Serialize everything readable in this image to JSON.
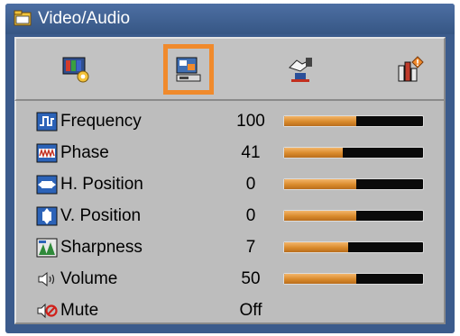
{
  "window": {
    "title": "Video/Audio",
    "title_icon": "folder-icon"
  },
  "tabs": [
    {
      "icon": "image-settings-icon",
      "active": false
    },
    {
      "icon": "video-audio-icon",
      "active": true
    },
    {
      "icon": "setup-hand-icon",
      "active": false
    },
    {
      "icon": "options-icon",
      "active": false
    }
  ],
  "items": [
    {
      "label": "Frequency",
      "value": "100",
      "icon": "frequency-icon",
      "level": 0.52
    },
    {
      "label": "Phase",
      "value": "41",
      "icon": "phase-icon",
      "level": 0.42
    },
    {
      "label": "H. Position",
      "value": "0",
      "icon": "h-position-icon",
      "level": 0.52
    },
    {
      "label": "V. Position",
      "value": "0",
      "icon": "v-position-icon",
      "level": 0.52
    },
    {
      "label": "Sharpness",
      "value": "7",
      "icon": "sharpness-icon",
      "level": 0.46
    },
    {
      "label": "Volume",
      "value": "50",
      "icon": "volume-icon",
      "level": 0.52
    },
    {
      "label": "Mute",
      "value": "Off",
      "icon": "mute-icon"
    }
  ],
  "colors": {
    "title_bar": "#3b5b8c",
    "active_tab_border": "#f08a2c",
    "slider_fill": "#d98a2b",
    "panel": "#bdbdbd"
  }
}
